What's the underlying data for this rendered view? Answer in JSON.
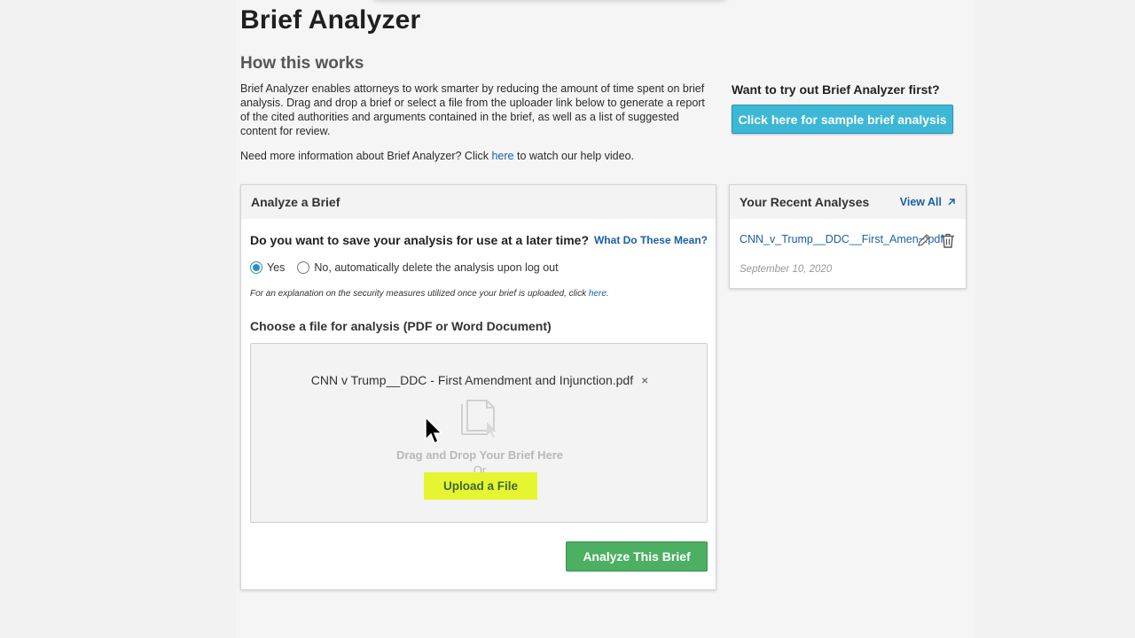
{
  "page": {
    "title": "Brief Analyzer",
    "subtitle": "How this works",
    "intro": "Brief Analyzer enables attorneys to work smarter by reducing the amount of time spent on brief analysis. Drag and drop a brief or select a file from the uploader link below to generate a report of the cited authorities and arguments contained in the brief, as well as a list of suggested content for review.",
    "help_prefix": "Need more information about Brief Analyzer? Click ",
    "help_link": "here",
    "help_suffix": " to watch our help video."
  },
  "sample": {
    "label": "Want to try out Brief Analyzer first?",
    "button": "Click here for sample brief analysis"
  },
  "analyze": {
    "header": "Analyze a Brief",
    "question": "Do you want to save your analysis for use at a later time?",
    "question_link": "What Do These Mean?",
    "options": [
      "Yes",
      "No, automatically delete the analysis upon log out"
    ],
    "selected_option": "Yes",
    "security_prefix": "For an explanation on the security measures utilized once your brief is uploaded, click ",
    "security_link": "here",
    "security_suffix": ".",
    "choose_label": "Choose a file for analysis (PDF or Word Document)",
    "file_name": "CNN v Trump__DDC - First Amendment and Injunction.pdf",
    "remove_symbol": "×",
    "drag_text": "Drag and Drop Your Brief Here",
    "or_text": "Or",
    "upload_button": "Upload a File",
    "analyze_button": "Analyze This Brief"
  },
  "recent": {
    "header": "Your Recent Analyses",
    "view_all": "View All",
    "items": [
      {
        "name": "CNN_v_Trump__DDC__First_Amen~.pdf",
        "date": "September 10, 2020"
      }
    ]
  },
  "colors": {
    "link": "#1a5fa8",
    "sample_button": "#3cb7d6",
    "analyze_button": "#4caf62",
    "upload_highlight": "#e6f531"
  },
  "icons": [
    "document-icon",
    "edit-icon",
    "trash-icon",
    "external-arrow-icon",
    "mouse-cursor-icon"
  ]
}
